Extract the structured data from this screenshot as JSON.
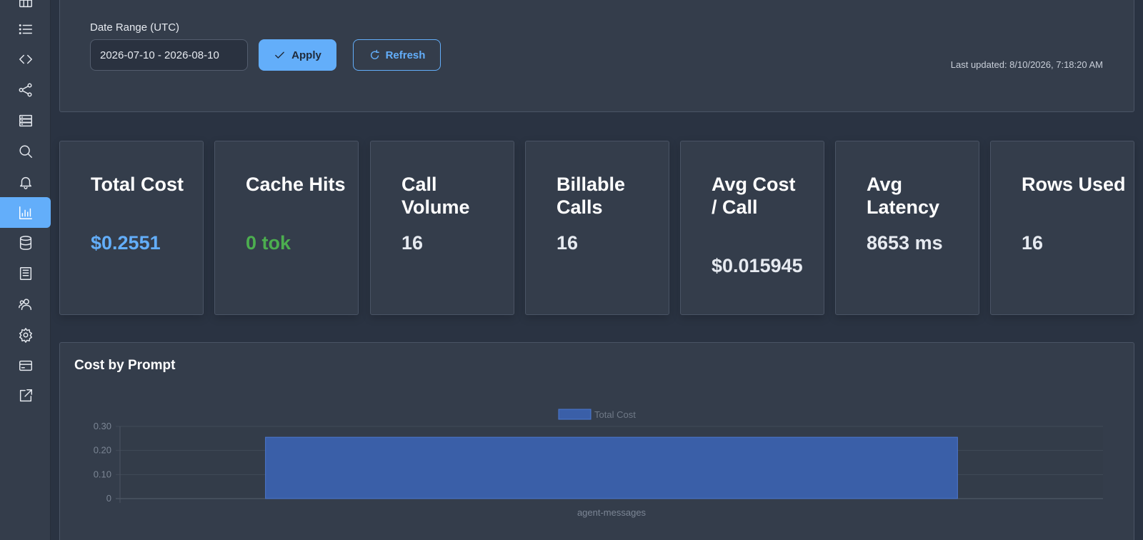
{
  "sidebar": {
    "items": [
      {
        "icon": "table-icon",
        "active": false
      },
      {
        "icon": "list-icon",
        "active": false
      },
      {
        "icon": "code-icon",
        "active": false
      },
      {
        "icon": "share-icon",
        "active": false
      },
      {
        "icon": "server-icon",
        "active": false
      },
      {
        "icon": "search-icon",
        "active": false
      },
      {
        "icon": "bell-icon",
        "active": false
      },
      {
        "icon": "bar-chart-icon",
        "active": true
      },
      {
        "icon": "database-icon",
        "active": false
      },
      {
        "icon": "book-icon",
        "active": false
      },
      {
        "icon": "users-icon",
        "active": false
      },
      {
        "icon": "gear-icon",
        "active": false
      },
      {
        "icon": "credit-card-icon",
        "active": false
      },
      {
        "icon": "external-link-icon",
        "active": false
      }
    ],
    "active_color": "#63aefa"
  },
  "filter": {
    "label": "Date Range (UTC)",
    "date_value": "2026-07-10 - 2026-08-10",
    "apply_label": "Apply",
    "refresh_label": "Refresh",
    "last_updated": "Last updated: 8/10/2026, 7:18:20 AM"
  },
  "stats": [
    {
      "title": "Total Cost",
      "value": "$0.2551",
      "color": "#63aefa"
    },
    {
      "title": "Cache Hits",
      "value": "0 tok",
      "color": "#4cae4f"
    },
    {
      "title": "Call Volume",
      "value": "16",
      "color": "#e6eaf0"
    },
    {
      "title": "Billable Calls",
      "value": "16",
      "color": "#e6eaf0"
    },
    {
      "title": "Avg Cost / Call",
      "value": "$0.015945",
      "color": "#e6eaf0"
    },
    {
      "title": "Avg Latency",
      "value": "8653 ms",
      "color": "#e6eaf0"
    },
    {
      "title": "Rows Used",
      "value": "16",
      "color": "#e6eaf0"
    }
  ],
  "chart": {
    "title": "Cost by Prompt"
  },
  "chart_data": {
    "type": "bar",
    "categories": [
      "agent-messages"
    ],
    "series": [
      {
        "name": "Total Cost",
        "values": [
          0.2551
        ],
        "color": "#3a5fa8"
      }
    ],
    "yticks": [
      "0",
      "0.10",
      "0.20",
      "0.30"
    ],
    "ylim": [
      0,
      0.3
    ],
    "grid": true,
    "legend": "top-center"
  }
}
